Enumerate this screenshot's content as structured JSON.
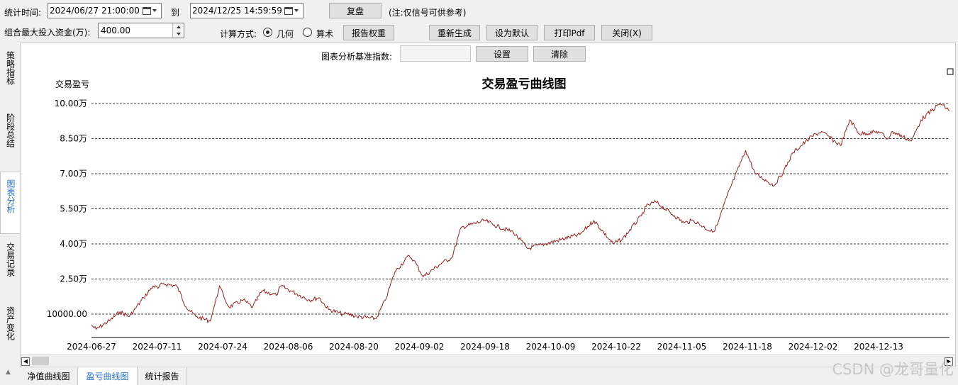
{
  "toolbar": {
    "period_label": "统计时间:",
    "start_date": "2024/06/27 21:00:00",
    "to_label": "到",
    "end_date": "2024/12/25 14:59:59",
    "replay_button": "复盘",
    "note": "(注:仅信号可供参考)",
    "max_capital_label": "组合最大投入资金(万):",
    "max_capital_value": "400.00",
    "calc_method_label": "计算方式:",
    "radio_geometric": "几何",
    "radio_arithmetic": "算术",
    "report_weight_button": "报告权重",
    "regenerate_button": "重新生成",
    "set_default_button": "设为默认",
    "print_pdf_button": "打印Pdf",
    "close_button": "关闭(X)"
  },
  "side_tabs": [
    {
      "label": "策略指标",
      "active": false
    },
    {
      "label": "阶段总结",
      "active": false
    },
    {
      "label": "图表分析",
      "active": true
    },
    {
      "label": "交易记录",
      "active": false
    },
    {
      "label": "资产变化",
      "active": false
    }
  ],
  "benchmark": {
    "label": "图表分析基准指数:",
    "value": "",
    "set_button": "设置",
    "clear_button": "清除"
  },
  "bottom_tabs": [
    {
      "label": "净值曲线图",
      "active": false
    },
    {
      "label": "盈亏曲线图",
      "active": true
    },
    {
      "label": "统计报告",
      "active": false
    }
  ],
  "watermark": "CSDN @龙哥量化",
  "colors": {
    "line": "#9b1c1c",
    "active_tab": "#1e6fd0"
  },
  "chart_data": {
    "type": "line",
    "title": "交易盈亏曲线图",
    "ylabel": "交易盈亏",
    "ylim": [
      0,
      100000
    ],
    "yticks": [
      10000,
      25000,
      40000,
      55000,
      70000,
      85000,
      100000
    ],
    "ytick_labels": [
      "10000.00",
      "2.50万",
      "4.00万",
      "5.50万",
      "7.00万",
      "8.50万",
      "10.00万"
    ],
    "xtick_labels": [
      "2024-06-27",
      "2024-07-11",
      "2024-07-24",
      "2024-08-06",
      "2024-08-20",
      "2024-09-02",
      "2024-09-18",
      "2024-10-09",
      "2024-10-22",
      "2024-11-05",
      "2024-11-18",
      "2024-12-02",
      "2024-12-13"
    ],
    "grid": "horizontal-dashed",
    "series": [
      {
        "x": [
          "2024-06-27",
          "2024-06-28",
          "2024-07-01",
          "2024-07-03",
          "2024-07-05",
          "2024-07-08",
          "2024-07-10",
          "2024-07-11",
          "2024-07-12",
          "2024-07-15",
          "2024-07-17",
          "2024-07-19",
          "2024-07-22",
          "2024-07-23",
          "2024-07-24",
          "2024-07-25",
          "2024-07-26",
          "2024-07-29",
          "2024-07-31",
          "2024-08-02",
          "2024-08-05",
          "2024-08-06",
          "2024-08-08",
          "2024-08-12",
          "2024-08-14",
          "2024-08-16",
          "2024-08-19",
          "2024-08-20",
          "2024-08-22",
          "2024-08-26",
          "2024-08-28",
          "2024-08-30",
          "2024-09-02",
          "2024-09-03",
          "2024-09-05",
          "2024-09-09",
          "2024-09-11",
          "2024-09-13",
          "2024-09-18",
          "2024-09-20",
          "2024-09-24",
          "2024-09-27",
          "2024-10-08",
          "2024-10-09",
          "2024-10-11",
          "2024-10-15",
          "2024-10-17",
          "2024-10-21",
          "2024-10-22",
          "2024-10-24",
          "2024-10-28",
          "2024-10-30",
          "2024-11-01",
          "2024-11-05",
          "2024-11-06",
          "2024-11-08",
          "2024-11-12",
          "2024-11-14",
          "2024-11-18",
          "2024-11-20",
          "2024-11-22",
          "2024-11-26",
          "2024-11-28",
          "2024-12-02",
          "2024-12-04",
          "2024-12-06",
          "2024-12-10",
          "2024-12-12",
          "2024-12-13",
          "2024-12-17",
          "2024-12-19",
          "2024-12-23",
          "2024-12-25"
        ],
        "values": [
          5200,
          3500,
          7500,
          11000,
          9000,
          17000,
          22000,
          21000,
          23000,
          22000,
          13000,
          9000,
          7000,
          14000,
          22000,
          17000,
          13000,
          16000,
          13000,
          20000,
          18000,
          22000,
          20000,
          16000,
          17000,
          12000,
          10000,
          10000,
          9000,
          8000,
          16000,
          28000,
          35000,
          33000,
          26000,
          32000,
          34000,
          47000,
          50000,
          48000,
          45000,
          38000,
          44000,
          46000,
          50000,
          40000,
          42000,
          52000,
          56000,
          58000,
          52000,
          49000,
          50000,
          45000,
          48000,
          60000,
          80000,
          70000,
          65000,
          71000,
          79000,
          86000,
          88000,
          82000,
          93000,
          87000,
          88000,
          85000,
          88000,
          84000,
          93000,
          100000,
          97000
        ]
      }
    ]
  }
}
